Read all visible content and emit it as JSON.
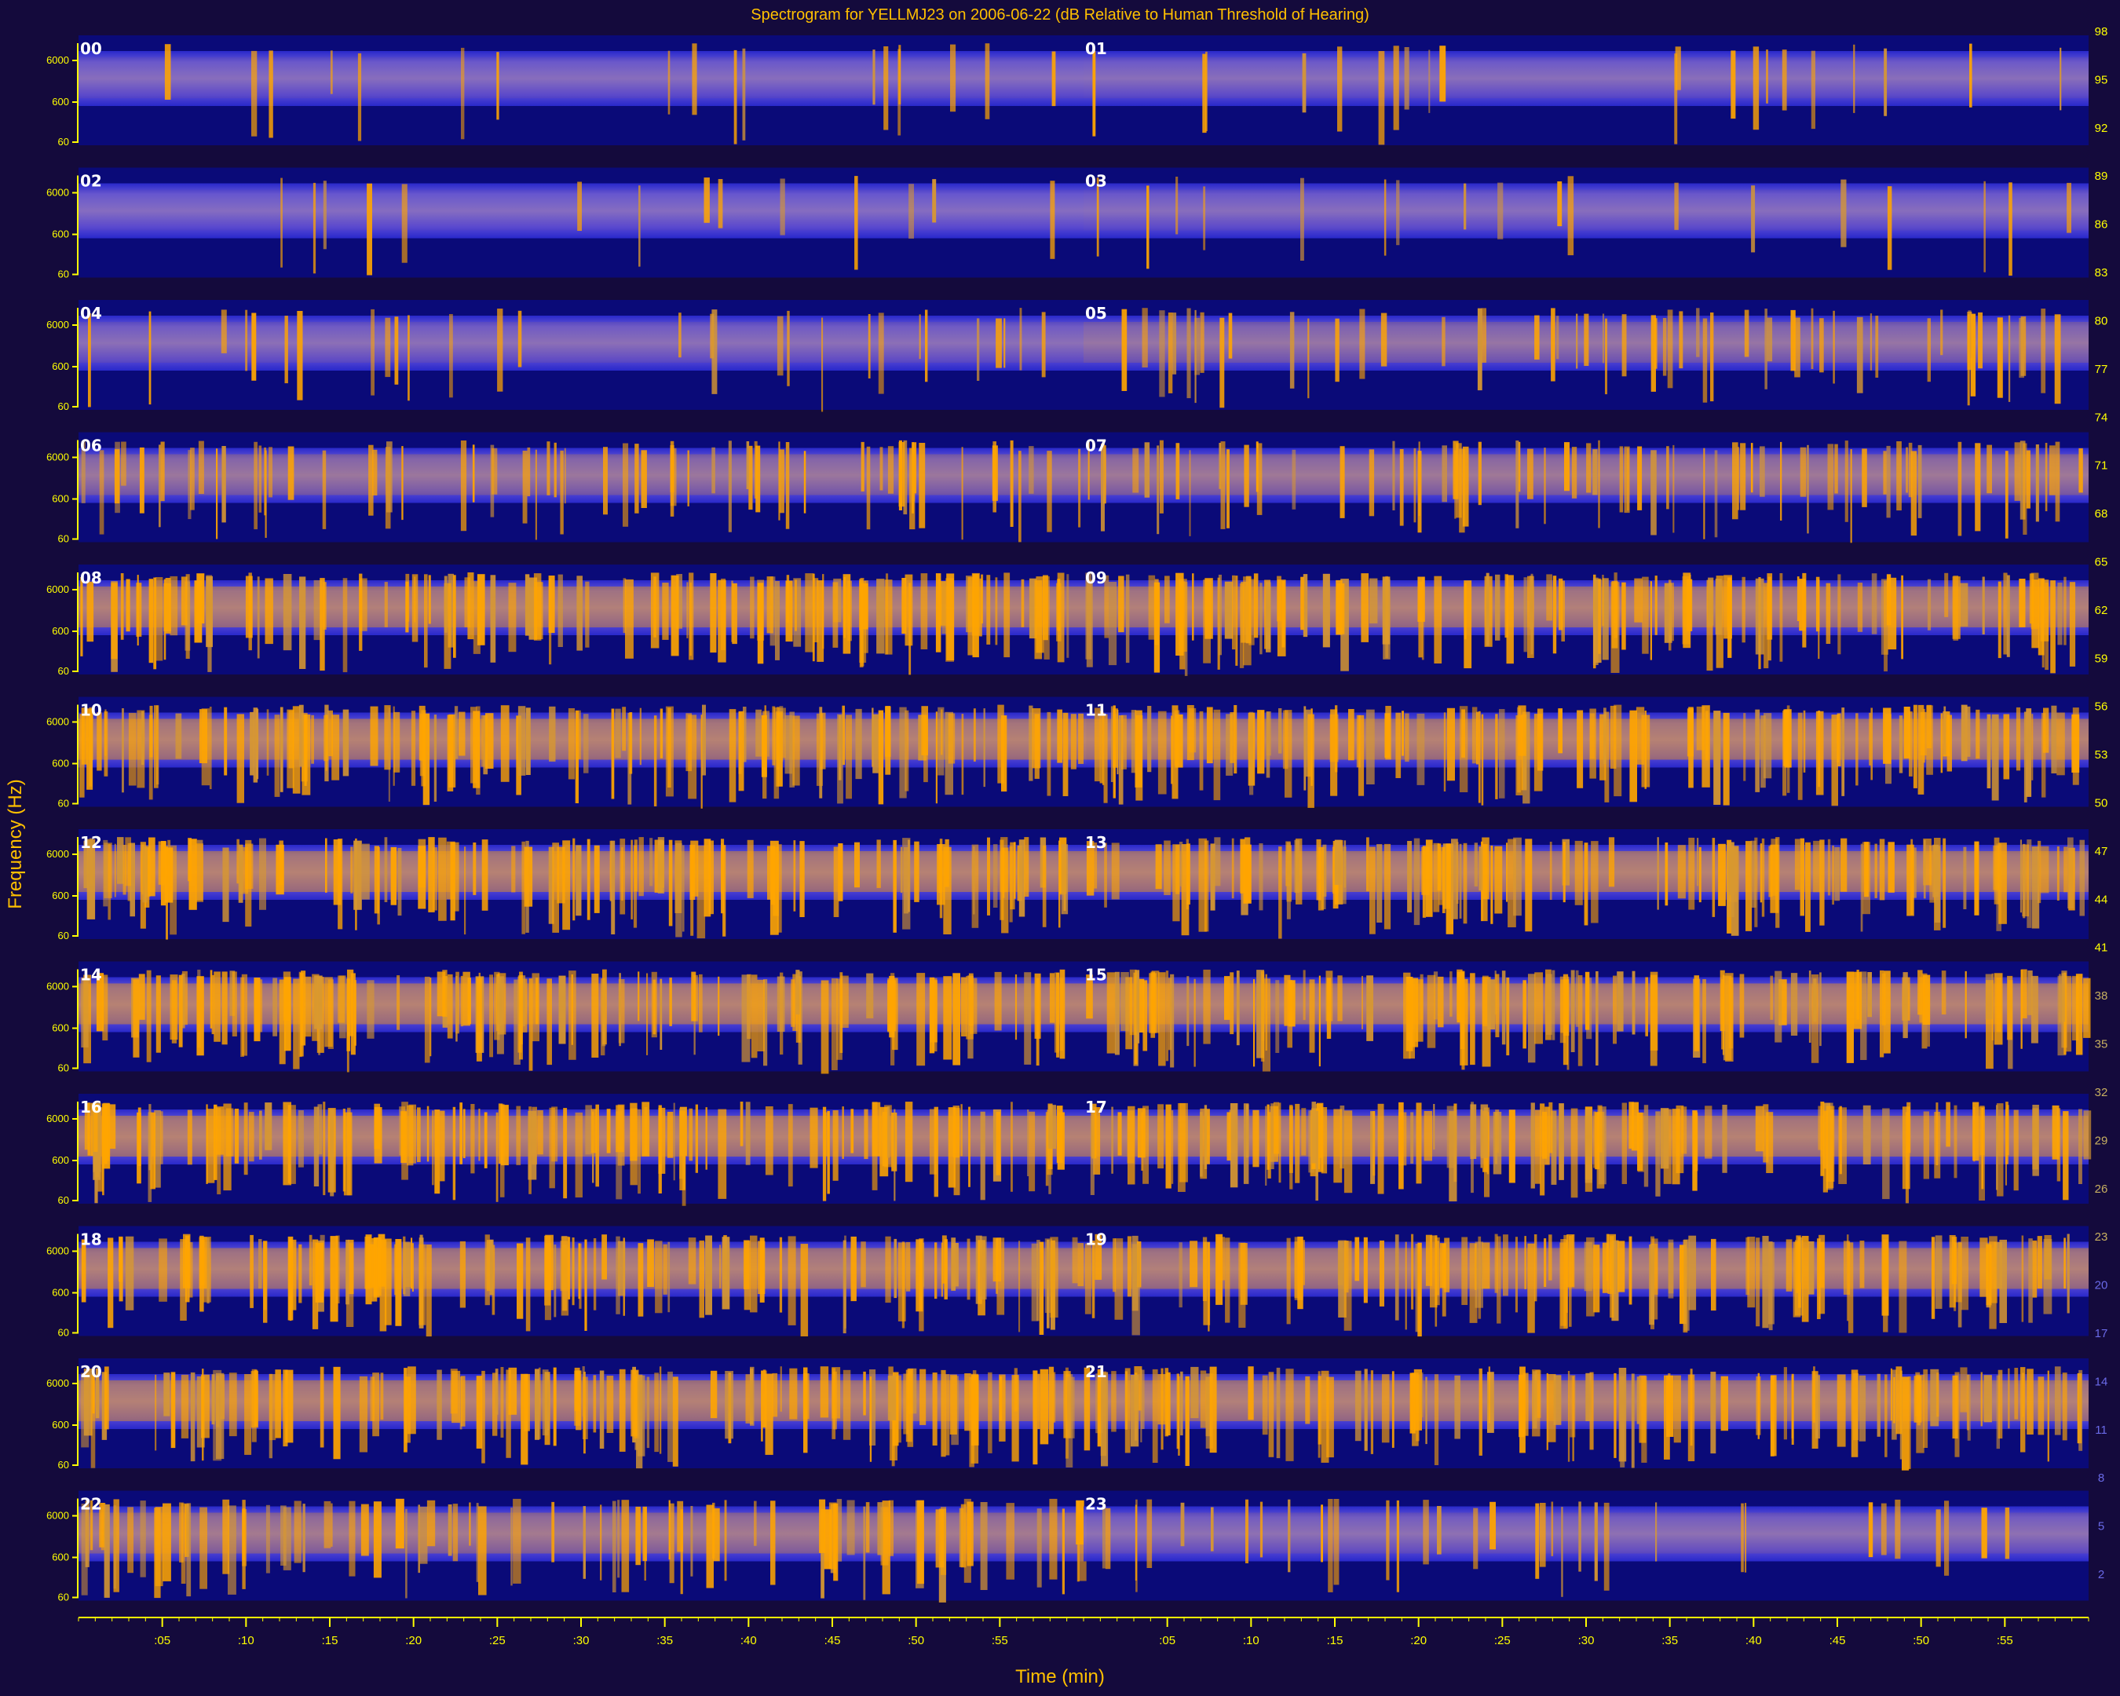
{
  "chart_data": {
    "type": "heatmap",
    "title": "Spectrogram for YELLMJ23 on 2006-06-22 (dB Relative to Human Threshold of Hearing)",
    "xlabel": "Time (min)",
    "ylabel": "Frequency (Hz)",
    "segments": [
      "00",
      "01",
      "02",
      "03",
      "04",
      "05",
      "06",
      "07",
      "08",
      "09",
      "10",
      "11",
      "12",
      "13",
      "14",
      "15",
      "16",
      "17",
      "18",
      "19",
      "20",
      "21",
      "22",
      "23"
    ],
    "y_tick_labels": [
      "6000",
      "600",
      "60"
    ],
    "x_tick_labels": [
      ":05",
      ":10",
      ":15",
      ":20",
      ":25",
      ":30",
      ":35",
      ":40",
      ":45",
      ":50",
      ":55"
    ],
    "colorbar_labels": [
      "98",
      "95",
      "92",
      "89",
      "86",
      "83",
      "80",
      "77",
      "74",
      "71",
      "68",
      "65",
      "62",
      "59",
      "56",
      "53",
      "50",
      "47",
      "44",
      "41",
      "38",
      "35",
      "32",
      "29",
      "26",
      "23",
      "20",
      "17",
      "14",
      "11",
      "8",
      "5",
      "2"
    ],
    "colorbar_range_db": [
      2,
      98
    ],
    "segment_activity": [
      0.08,
      0.1,
      0.05,
      0.08,
      0.15,
      0.35,
      0.45,
      0.5,
      0.85,
      0.85,
      0.9,
      0.9,
      0.9,
      0.9,
      0.92,
      0.92,
      0.92,
      0.92,
      0.85,
      0.85,
      0.88,
      0.85,
      0.6,
      0.2
    ],
    "colors": {
      "background": "#140a3c",
      "low": "#0a0a7a",
      "mid": "#3a3ad8",
      "high": "#ffa000",
      "axis": "#ffff00"
    }
  }
}
